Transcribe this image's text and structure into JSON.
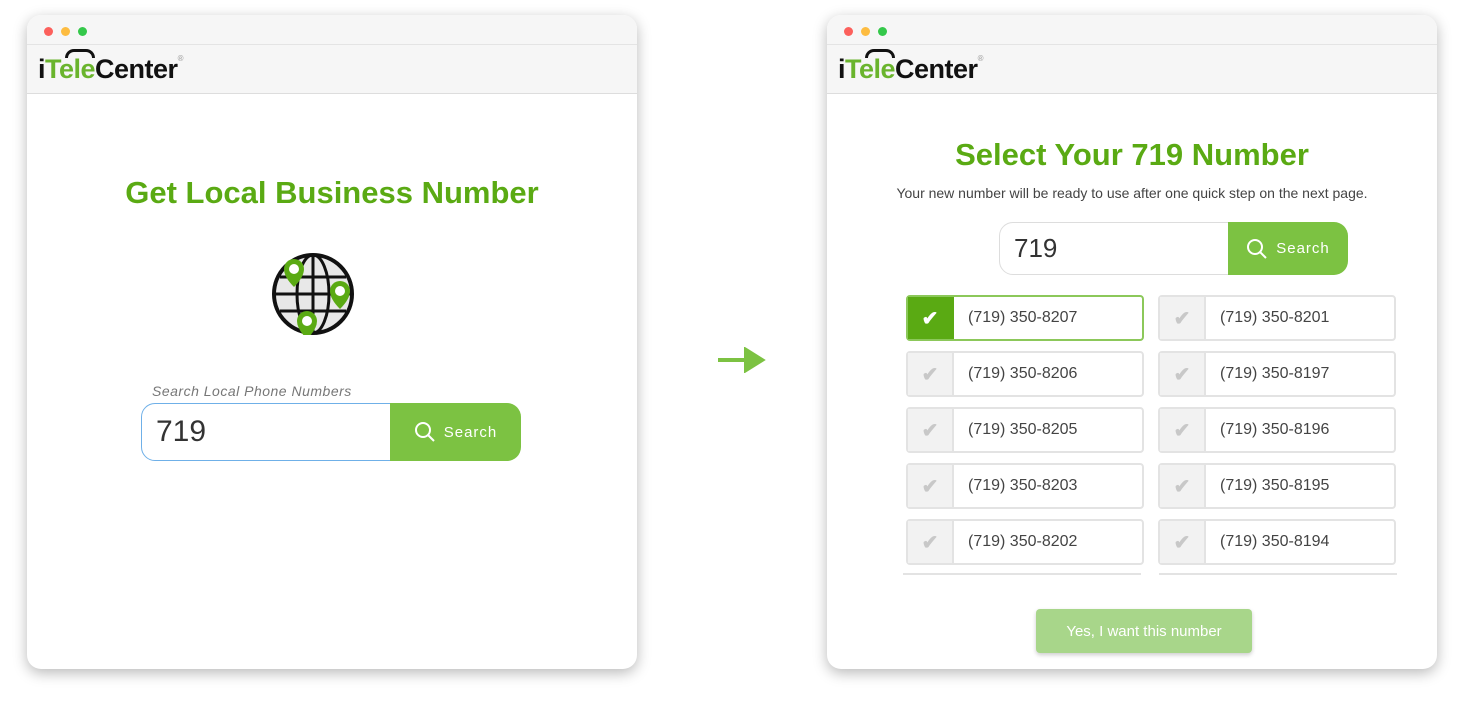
{
  "brand": {
    "logo_prefix": "i",
    "logo_green": "Tele",
    "logo_suffix": "Center",
    "registered": "®"
  },
  "colors": {
    "accent": "#5aaa13",
    "button": "#7cc242",
    "cta": "#a8d68a"
  },
  "left": {
    "title": "Get Local Business Number",
    "search_label": "Search Local Phone Numbers",
    "search_value": "719",
    "search_button": "Search",
    "icon": "globe-with-map-pins-icon"
  },
  "right": {
    "title": "Select Your 719 Number",
    "subtitle": "Your new number will be ready to use after one quick step on the next page.",
    "search_value": "719",
    "search_button": "Search",
    "numbers": [
      {
        "number": "(719) 350-8207",
        "selected": true
      },
      {
        "number": "(719) 350-8201",
        "selected": false
      },
      {
        "number": "(719) 350-8206",
        "selected": false
      },
      {
        "number": "(719) 350-8197",
        "selected": false
      },
      {
        "number": "(719) 350-8205",
        "selected": false
      },
      {
        "number": "(719) 350-8196",
        "selected": false
      },
      {
        "number": "(719) 350-8203",
        "selected": false
      },
      {
        "number": "(719) 350-8195",
        "selected": false
      },
      {
        "number": "(719) 350-8202",
        "selected": false
      },
      {
        "number": "(719) 350-8194",
        "selected": false
      }
    ],
    "cta": "Yes, I want this number"
  }
}
